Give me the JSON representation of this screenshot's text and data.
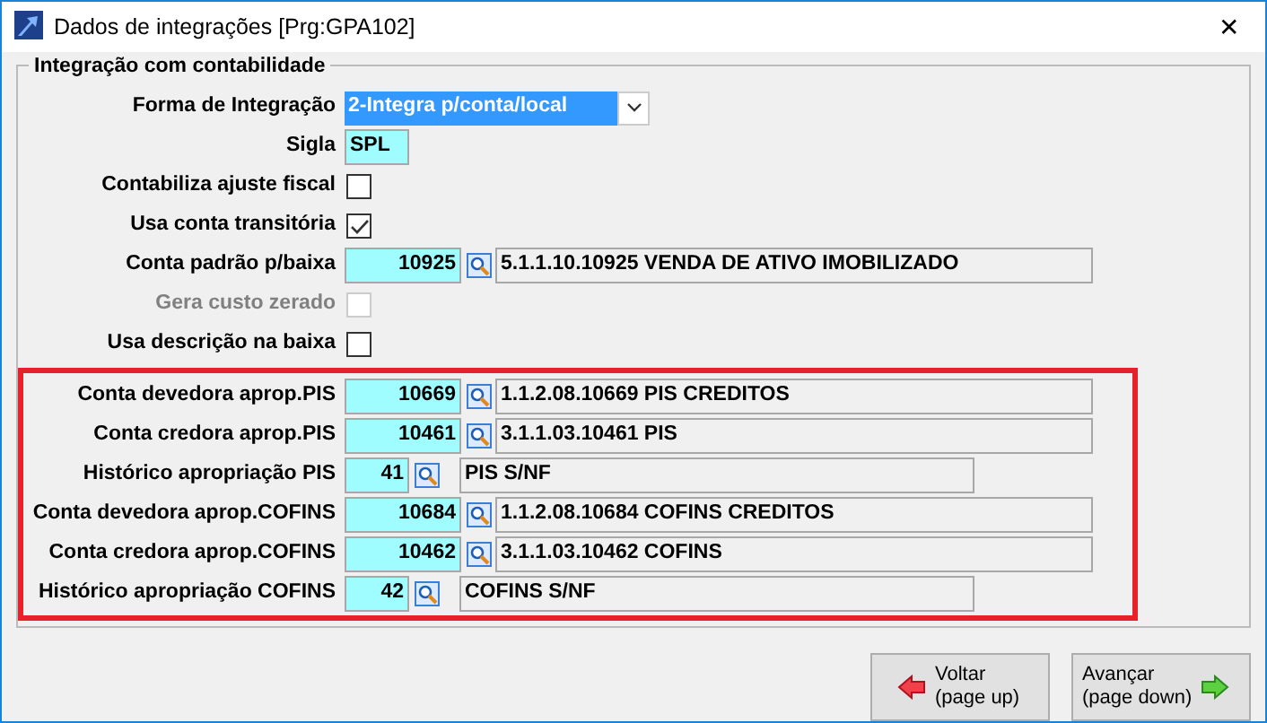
{
  "window": {
    "title": "Dados de integrações [Prg:GPA102]",
    "close": "✕"
  },
  "group": {
    "title": "Integração com contabilidade",
    "rows": [
      {
        "kind": "select",
        "label": "Forma de Integração",
        "value": "2-Integra p/conta/local"
      },
      {
        "kind": "text",
        "label": "Sigla",
        "value": "SPL"
      },
      {
        "kind": "checkbox",
        "label": "Contabiliza ajuste fiscal",
        "checked": false,
        "disabled": false
      },
      {
        "kind": "checkbox",
        "label": "Usa conta transitória",
        "checked": true,
        "disabled": false
      },
      {
        "kind": "lookup",
        "label": "Conta padrão p/baixa",
        "value": "10925",
        "description": "5.1.1.10.10925 VENDA DE ATIVO IMOBILIZADO"
      },
      {
        "kind": "checkbox",
        "label": "Gera custo zerado",
        "checked": false,
        "disabled": true
      },
      {
        "kind": "checkbox",
        "label": "Usa descrição na baixa",
        "checked": false,
        "disabled": false
      }
    ],
    "highlighted_rows": [
      {
        "kind": "lookup",
        "label": "Conta devedora aprop.PIS",
        "value": "10669",
        "description": "1.1.2.08.10669 PIS CREDITOS"
      },
      {
        "kind": "lookup",
        "label": "Conta credora aprop.PIS",
        "value": "10461",
        "description": "3.1.1.03.10461 PIS"
      },
      {
        "kind": "history",
        "label": "Histórico apropriação PIS",
        "value": "41",
        "description": "PIS S/NF"
      },
      {
        "kind": "lookup",
        "label": "Conta devedora aprop.COFINS",
        "value": "10684",
        "description": "1.1.2.08.10684 COFINS CREDITOS"
      },
      {
        "kind": "lookup",
        "label": "Conta credora aprop.COFINS",
        "value": "10462",
        "description": "3.1.1.03.10462 COFINS"
      },
      {
        "kind": "history",
        "label": "Histórico apropriação COFINS",
        "value": "42",
        "description": "COFINS S/NF"
      }
    ]
  },
  "buttons": [
    {
      "kind": "back",
      "label": "Voltar",
      "hint": "(page up)"
    },
    {
      "kind": "next",
      "label": "Avançar",
      "hint": "(page down)"
    }
  ]
}
